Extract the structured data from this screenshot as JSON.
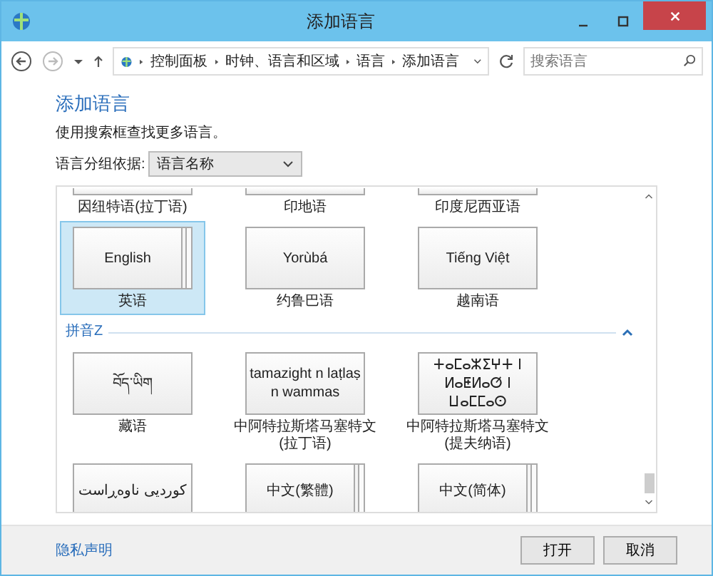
{
  "window": {
    "title": "添加语言"
  },
  "address_bar": {
    "crumbs": [
      "控制面板",
      "时钟、语言和区域",
      "语言",
      "添加语言"
    ]
  },
  "search": {
    "placeholder": "搜索语言"
  },
  "heading": "添加语言",
  "description": "使用搜索框查找更多语言。",
  "group_by": {
    "label": "语言分组依据:",
    "value": "语言名称"
  },
  "rows": [
    {
      "kind": "cut",
      "tiles": [
        {
          "label": "因纽特语(拉丁语)",
          "selected": false,
          "stacked": false
        },
        {
          "label": "印地语",
          "selected": false,
          "stacked": false
        },
        {
          "label": "印度尼西亚语",
          "selected": false,
          "stacked": false
        }
      ]
    },
    {
      "kind": "full",
      "tiles": [
        {
          "native": "English",
          "label": "英语",
          "selected": true,
          "stacked": true
        },
        {
          "native": "Yorùbá",
          "label": "约鲁巴语",
          "selected": false,
          "stacked": false
        },
        {
          "native": "Tiếng Việt",
          "label": "越南语",
          "selected": false,
          "stacked": false
        }
      ]
    },
    {
      "kind": "group",
      "title": "拼音Z"
    },
    {
      "kind": "full",
      "tiles": [
        {
          "native": "བོད་ཡིག",
          "label": "藏语",
          "selected": false,
          "stacked": false
        },
        {
          "native": "tamazight n laṭlaṣ n wammas",
          "label": "中阿特拉斯塔马塞特文(拉丁语)",
          "selected": false,
          "stacked": false
        },
        {
          "native": "ⵜⴰⵎⴰⵣⵉⵖⵜ ⵏ ⵍⴰⵟⵍⴰⵚ ⵏ ⵡⴰⵎⵎⴰⵙ",
          "label": "中阿特拉斯塔马塞特文(提夫纳语)",
          "selected": false,
          "stacked": false
        }
      ]
    },
    {
      "kind": "top",
      "tiles": [
        {
          "native": "کوردیی ناوەڕاست",
          "selected": false,
          "stacked": false
        },
        {
          "native": "中文(繁體)",
          "selected": false,
          "stacked": true
        },
        {
          "native": "中文(简体)",
          "selected": false,
          "stacked": true
        }
      ]
    }
  ],
  "footer": {
    "link": "隐私声明",
    "buttons": [
      "打开",
      "取消"
    ]
  }
}
